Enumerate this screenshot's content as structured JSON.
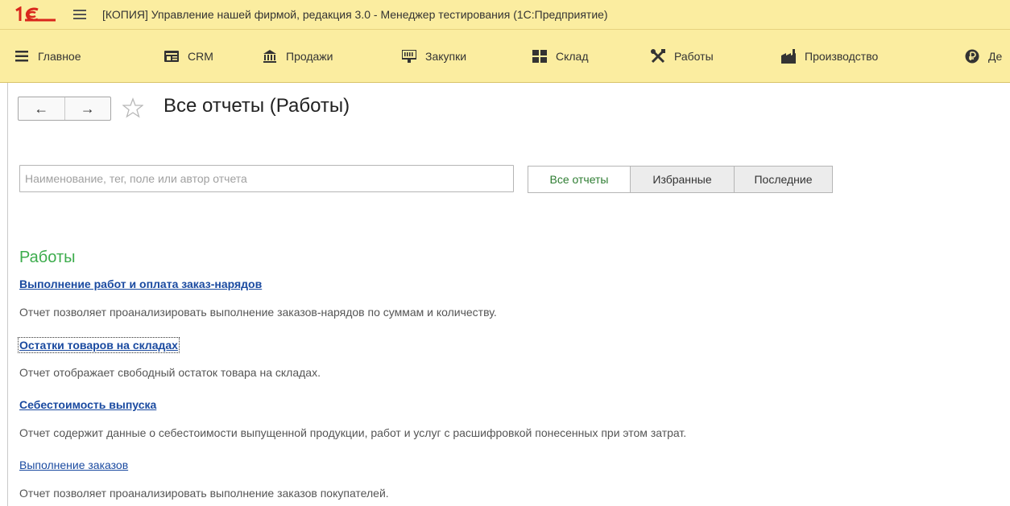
{
  "window": {
    "title": "[КОПИЯ] Управление нашей фирмой, редакция 3.0  - Менеджер тестирования (1С:Предприятие)",
    "logo_text": "1С"
  },
  "sections": [
    {
      "label": "Главное",
      "icon": "menu-lines-icon"
    },
    {
      "label": "CRM",
      "icon": "crm-card-icon"
    },
    {
      "label": "Продажи",
      "icon": "bank-building-icon"
    },
    {
      "label": "Закупки",
      "icon": "barcode-scanner-icon"
    },
    {
      "label": "Склад",
      "icon": "warehouse-grid-icon"
    },
    {
      "label": "Работы",
      "icon": "tools-icon"
    },
    {
      "label": "Производство",
      "icon": "factory-icon"
    },
    {
      "label": "Де",
      "icon": "ruble-circle-icon"
    }
  ],
  "nav": {
    "back": "←",
    "forward": "→"
  },
  "page": {
    "title": "Все отчеты (Работы)"
  },
  "search": {
    "placeholder": "Наименование, тег, поле или автор отчета",
    "value": ""
  },
  "filters": [
    {
      "label": "Все отчеты",
      "active": true
    },
    {
      "label": "Избранные",
      "active": false
    },
    {
      "label": "Последние",
      "active": false
    }
  ],
  "group": {
    "title": "Работы",
    "reports": [
      {
        "name": "Выполнение работ и оплата заказ-нарядов",
        "description": "Отчет позволяет проанализировать выполнение заказов-нарядов по суммам и количеству."
      },
      {
        "name": "Остатки товаров на складах",
        "description": "Отчет отображает свободный остаток товара на складах."
      },
      {
        "name": "Себестоимость выпуска",
        "description": "Отчет содержит данные о себестоимости выпущенной продукции, работ и услуг с расшифровкой понесенных при этом затрат."
      },
      {
        "name": "Выполнение заказов",
        "description": "Отчет позволяет проанализировать выполнение заказов покупателей."
      }
    ]
  },
  "colors": {
    "titlebar": "#fbeda0",
    "group_title": "#3cac4c",
    "link": "#1a4aa0",
    "logo": "#d9261c"
  }
}
